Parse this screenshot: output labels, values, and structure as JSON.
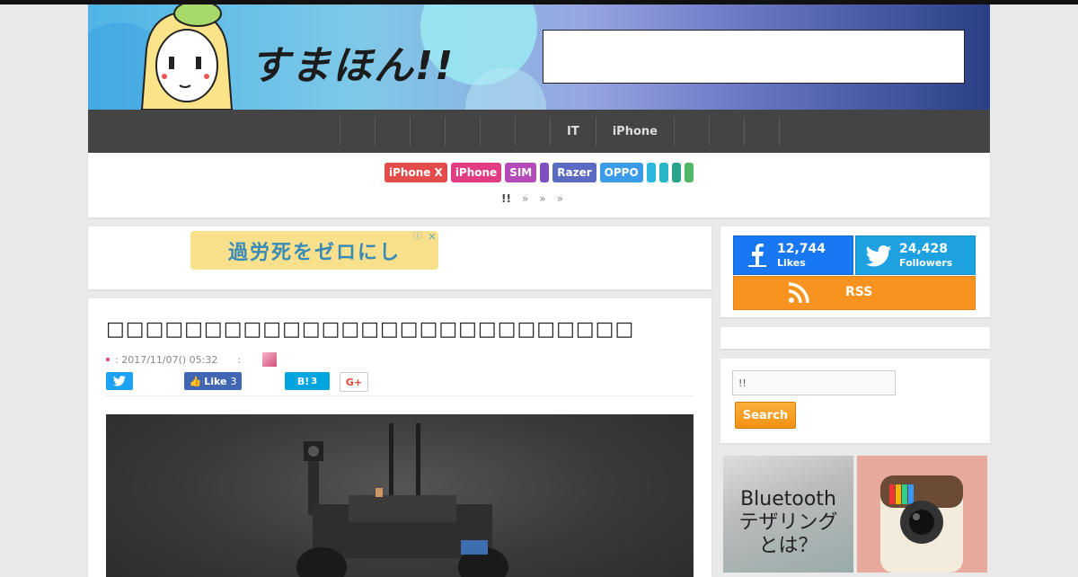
{
  "header": {
    "logo_text": "すまほん!!"
  },
  "nav": {
    "items": [
      "",
      "",
      "",
      "",
      "",
      "",
      "IT",
      "iPhone",
      "",
      "",
      ""
    ]
  },
  "tags": [
    {
      "label": "iPhone X",
      "color": "#e44b4b"
    },
    {
      "label": "iPhone",
      "color": "#e23d82"
    },
    {
      "label": "SIM",
      "color": "#b54ab9"
    },
    {
      "label": "",
      "color": "#7e4fc2"
    },
    {
      "label": "Razer",
      "color": "#5a6bc1"
    },
    {
      "label": "OPPO",
      "color": "#3c9be8"
    },
    {
      "label": "",
      "color": "#2ab8e0"
    },
    {
      "label": "",
      "color": "#28b5c4"
    },
    {
      "label": "",
      "color": "#2aa38c"
    },
    {
      "label": "",
      "color": "#52b868"
    }
  ],
  "breadcrumb": {
    "home": "!!",
    "sep": "»"
  },
  "ad": {
    "text": "過労死をゼロにし",
    "info": "ⓘ",
    "close": "✕"
  },
  "article": {
    "title": "□□□□□□□□□□□□□□□□□□□□□□□□□□□",
    "date": ": 2017/11/07() 05:32",
    "author_sep": ":",
    "share": {
      "facebook_label": "Like",
      "facebook_count": "3",
      "hatena_label": "B!",
      "hatena_count": "3",
      "gplus_label": "G+"
    }
  },
  "sidebar": {
    "facebook": {
      "count": "12,744",
      "label": "Likes"
    },
    "twitter": {
      "count": "24,428",
      "label": "Followers"
    },
    "rss": {
      "label": "RSS"
    },
    "search": {
      "value": "!!",
      "button": "Search"
    },
    "thumb1_text": "Bluetooth\nテザリング\nとは？"
  }
}
